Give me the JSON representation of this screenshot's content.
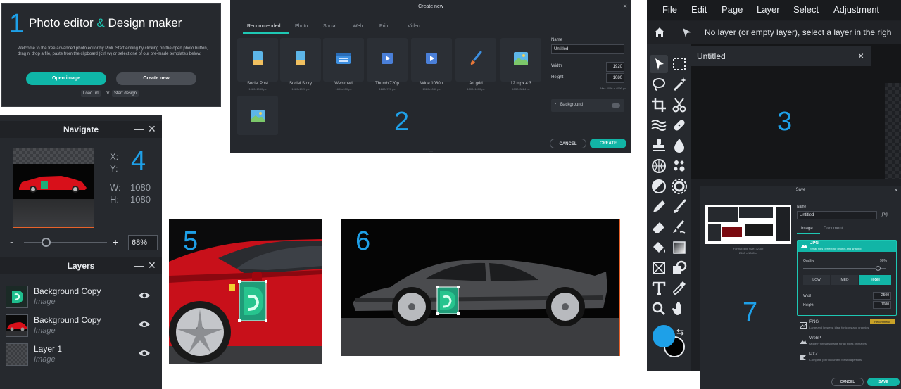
{
  "labels": [
    "1",
    "2",
    "3",
    "4",
    "5",
    "6",
    "7"
  ],
  "panel1": {
    "title_a": "Photo editor ",
    "title_amp": "&",
    "title_b": " Design maker",
    "description": "Welcome to the free advanced photo editor by Pixlr. Start editing by clicking on the open photo button, drag n' drop a file, paste from the clipboard (ctrl+v) or select one of our pre-made templates below.",
    "open_label": "Open image",
    "create_label": "Create new",
    "load_url_label": "Load url",
    "or_label": "or",
    "start_design_label": "Start design"
  },
  "panel2": {
    "title": "Create new",
    "close_glyph": "×",
    "tabs": [
      "Recommended",
      "Photo",
      "Social",
      "Web",
      "Print",
      "Video"
    ],
    "presets": [
      {
        "label": "Social Post",
        "size": "1080x1080 px",
        "icon": "image-portrait-icon"
      },
      {
        "label": "Social Story",
        "size": "1080x1920 px",
        "icon": "image-portrait-icon"
      },
      {
        "label": "Web med",
        "size": "1600x900 px",
        "icon": "browser-icon"
      },
      {
        "label": "Thumb 720p",
        "size": "1280x720 px",
        "icon": "video-icon"
      },
      {
        "label": "Wide 1080p",
        "size": "1920x1080 px",
        "icon": "video-icon"
      },
      {
        "label": "Art grid",
        "size": "1000x1000 px",
        "icon": "brush-icon"
      },
      {
        "label": "12 mpx 4:3",
        "size": "4032x3024 px",
        "icon": "landscape-icon"
      }
    ],
    "name_label": "Name",
    "name_value": "Untitled",
    "width_label": "Width",
    "width_value": "1920",
    "height_label": "Height",
    "height_value": "1080",
    "max_note": "Max 4096 x 4096 px",
    "background_label": "Background",
    "cancel_label": "CANCEL",
    "create_label": "CREATE",
    "accent": "#1ec8b4"
  },
  "panel3": {
    "menu": [
      "File",
      "Edit",
      "Page",
      "Layer",
      "Select",
      "Adjustment"
    ],
    "info_text": "No layer (or empty layer), select a layer in the righ",
    "doc_title": "Untitled",
    "close_glyph": "×",
    "primary_color": "#1ea0e8",
    "secondary_color": "#000000"
  },
  "panel4": {
    "navigate_title": "Navigate",
    "minimize_glyph": "—",
    "close_glyph": "✕",
    "x_label": "X:",
    "y_label": "Y:",
    "w_label": "W:",
    "w_value": "1080",
    "h_label": "H:",
    "h_value": "1080",
    "zoom_minus": "-",
    "zoom_plus": "+",
    "zoom_value": "68%",
    "zoom_level": 0.68,
    "layers_title": "Layers",
    "layers": [
      {
        "name": "Background Copy",
        "type": "Image"
      },
      {
        "name": "Background Copy",
        "type": "Image"
      },
      {
        "name": "Layer 1",
        "type": "Image"
      }
    ]
  },
  "panel7": {
    "title": "Save",
    "close_glyph": "×",
    "format_line": "Format: jpg, size: 323kb",
    "dims_line": "2500 x 1080px",
    "name_label": "Name",
    "name_value": "Untitled",
    "ext": ".jpg",
    "tabs": [
      "Image",
      "Document"
    ],
    "jpg_label": "JPG",
    "jpg_desc": "Small files perfect for photos and sharing",
    "quality_label": "Quality",
    "quality_value": "90%",
    "quality_level": 0.9,
    "quality_buttons": [
      "LOW",
      "MED",
      "HIGH"
    ],
    "width_label": "Width",
    "width_value": "2500",
    "height_label": "Height",
    "height_value": "1080",
    "png_label": "PNG",
    "png_desc": "Large and lossless, ideal for icons and graphics",
    "recommend_label": "Recommend",
    "webp_label": "WebP",
    "webp_desc": "Modern format suitable for all types of images",
    "pxz_label": "PXZ",
    "pxz_desc": "Complete pixlr document for storage/edits",
    "cancel_label": "CANCEL",
    "save_label": "SAVE"
  }
}
